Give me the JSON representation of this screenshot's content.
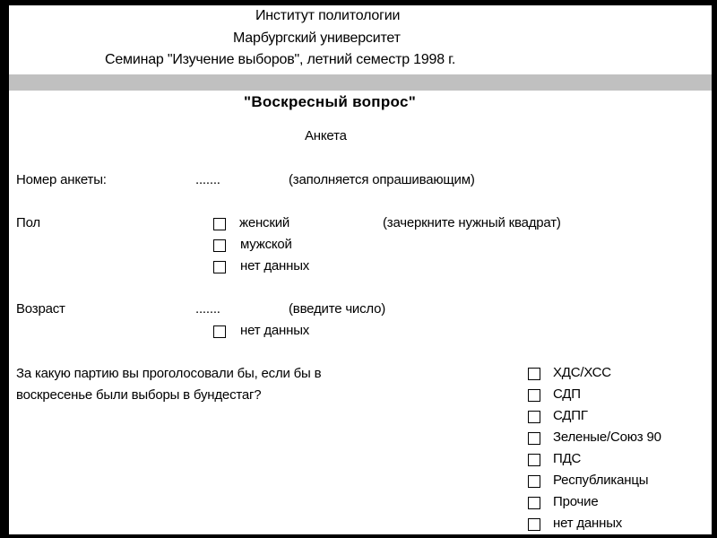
{
  "header": {
    "line1": "Институт политологии",
    "line2": "Марбургский университет",
    "line3": "Семинар \"Изучение выборов\", летний семестр 1998 г."
  },
  "title": "\"Воскресный вопрос\"",
  "subtitle": "Анкета",
  "questionnaire_number": {
    "label": "Номер анкеты:",
    "value": ".......",
    "note": "(заполняется опрашивающим)"
  },
  "sex": {
    "label": "Пол",
    "note": "(зачеркните нужный квадрат)",
    "options": [
      "женский",
      "мужской",
      "нет данных"
    ]
  },
  "age": {
    "label": "Возраст",
    "value": ".......",
    "note": "(введите число)",
    "options": [
      "нет данных"
    ]
  },
  "vote": {
    "question_line1": "За какую партию вы проголосовали бы, если бы в",
    "question_line2": "воскресенье были выборы в бундестаг?",
    "options": [
      "ХДС/ХСС",
      "СДП",
      "СДПГ",
      "Зеленые/Союз 90",
      "ПДС",
      "Республиканцы",
      "Прочие",
      "нет данных"
    ]
  },
  "colors": {
    "frame": "#000000",
    "band": "#c0c0c0",
    "background": "#ffffff"
  }
}
